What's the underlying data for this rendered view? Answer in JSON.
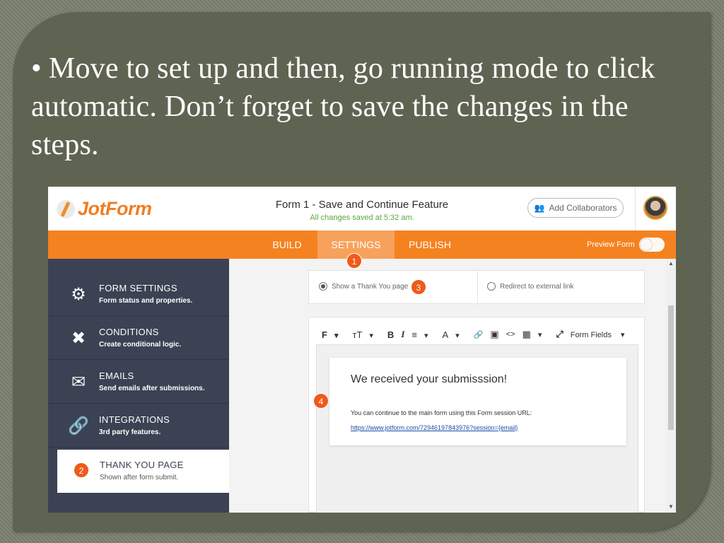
{
  "slide": {
    "bullet_symbol": "•",
    "text": "Move to set up and then, go running mode to click automatic. Don’t forget to save the changes in the steps."
  },
  "app": {
    "logo_text": "JotForm",
    "form_title": "Form 1 - Save and Continue Feature",
    "save_status": "All changes saved at 5:32 am.",
    "add_collaborators": "Add Collaborators",
    "nav_tabs": [
      {
        "label": "BUILD",
        "active": false
      },
      {
        "label": "SETTINGS",
        "active": true
      },
      {
        "label": "PUBLISH",
        "active": false
      }
    ],
    "preview_form": "Preview Form",
    "sidebar": [
      {
        "title": "FORM SETTINGS",
        "subtitle": "Form status and properties.",
        "icon": "gear-icon"
      },
      {
        "title": "CONDITIONS",
        "subtitle": "Create conditional logic.",
        "icon": "conditions-icon"
      },
      {
        "title": "EMAILS",
        "subtitle": "Send emails after submissions.",
        "icon": "envelope-icon"
      },
      {
        "title": "INTEGRATIONS",
        "subtitle": "3rd party features.",
        "icon": "link-icon"
      },
      {
        "title": "THANK YOU PAGE",
        "subtitle": "Shown after form submit.",
        "icon": "step-badge-2",
        "selected": true
      }
    ],
    "options": {
      "show_thank_you": "Show a Thank You page",
      "redirect": "Redirect to external link"
    },
    "toolbar": {
      "font": "F",
      "text_size": "ᴛT",
      "bold": "B",
      "italic": "I",
      "align": "≡",
      "font_color": "A",
      "link": "🔗",
      "image": "▣",
      "code": "<>",
      "table": "▦",
      "fullscreen": "⤢",
      "form_fields": "Form Fields"
    },
    "thank_you": {
      "heading": "We received your submisssion!",
      "text": "You can continue to the main form using this Form session URL:",
      "link": "https://www.jotform.com/72946197843976?session={email}"
    },
    "badges": [
      "1",
      "2",
      "3",
      "4"
    ]
  },
  "colors": {
    "orange": "#f58220",
    "sidebar": "#3b4253",
    "badge": "#f05a1a",
    "slide_panel": "#5f6452"
  }
}
